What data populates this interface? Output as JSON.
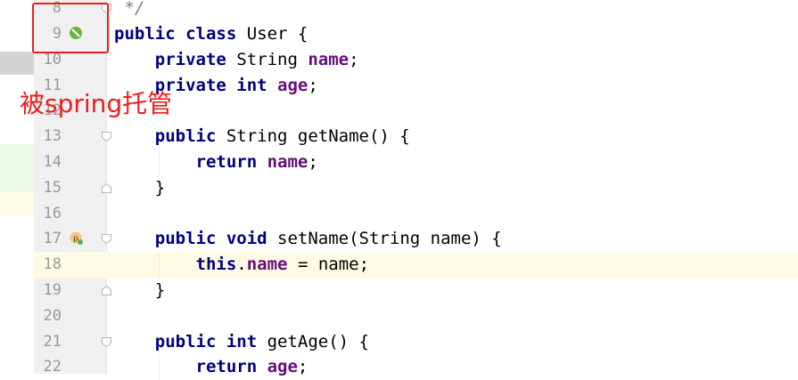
{
  "theme": {
    "keyword_color": "#000080",
    "field_color": "#660e7a",
    "comment_color": "#808080",
    "line_number_color": "#999999",
    "current_line_bg": "#fffae3",
    "annotation_color": "#e8201d",
    "gutter_bg": "#f0f0f0"
  },
  "annotation": {
    "text": "被spring托管"
  },
  "gutter_icons": {
    "line9": "spring-bean-icon",
    "line17": "property-setter-icon"
  },
  "editor": {
    "current_line": "18",
    "lines": [
      {
        "n": "8",
        "tokens": [
          {
            "t": " */",
            "c": "com"
          }
        ]
      },
      {
        "n": "9",
        "tokens": [
          {
            "t": "public ",
            "c": "kw"
          },
          {
            "t": "class ",
            "c": "kw"
          },
          {
            "t": "User {",
            "c": ""
          }
        ]
      },
      {
        "n": "10",
        "tokens": [
          {
            "t": "    ",
            "c": ""
          },
          {
            "t": "private ",
            "c": "kw"
          },
          {
            "t": "String ",
            "c": ""
          },
          {
            "t": "name",
            "c": "fld"
          },
          {
            "t": ";",
            "c": ""
          }
        ]
      },
      {
        "n": "11",
        "tokens": [
          {
            "t": "    ",
            "c": ""
          },
          {
            "t": "private ",
            "c": "kw"
          },
          {
            "t": "int ",
            "c": "kw"
          },
          {
            "t": "age",
            "c": "fld"
          },
          {
            "t": ";",
            "c": ""
          }
        ]
      },
      {
        "n": "12",
        "tokens": []
      },
      {
        "n": "13",
        "tokens": [
          {
            "t": "    ",
            "c": ""
          },
          {
            "t": "public ",
            "c": "kw"
          },
          {
            "t": "String getName() {",
            "c": ""
          }
        ]
      },
      {
        "n": "14",
        "tokens": [
          {
            "t": "        ",
            "c": ""
          },
          {
            "t": "return ",
            "c": "kw"
          },
          {
            "t": "name",
            "c": "fld"
          },
          {
            "t": ";",
            "c": ""
          }
        ]
      },
      {
        "n": "15",
        "tokens": [
          {
            "t": "    }",
            "c": ""
          }
        ]
      },
      {
        "n": "16",
        "tokens": []
      },
      {
        "n": "17",
        "tokens": [
          {
            "t": "    ",
            "c": ""
          },
          {
            "t": "public ",
            "c": "kw"
          },
          {
            "t": "void ",
            "c": "kw"
          },
          {
            "t": "setName(String name) {",
            "c": ""
          }
        ]
      },
      {
        "n": "18",
        "tokens": [
          {
            "t": "        ",
            "c": ""
          },
          {
            "t": "this",
            "c": "kw"
          },
          {
            "t": ".",
            "c": ""
          },
          {
            "t": "name",
            "c": "fld"
          },
          {
            "t": " = name;",
            "c": ""
          }
        ]
      },
      {
        "n": "19",
        "tokens": [
          {
            "t": "    }",
            "c": ""
          }
        ]
      },
      {
        "n": "20",
        "tokens": []
      },
      {
        "n": "21",
        "tokens": [
          {
            "t": "    ",
            "c": ""
          },
          {
            "t": "public ",
            "c": "kw"
          },
          {
            "t": "int ",
            "c": "kw"
          },
          {
            "t": "getAge() {",
            "c": ""
          }
        ]
      },
      {
        "n": "22",
        "tokens": [
          {
            "t": "        ",
            "c": ""
          },
          {
            "t": "return ",
            "c": "kw"
          },
          {
            "t": "age",
            "c": "fld"
          },
          {
            "t": ";",
            "c": ""
          }
        ]
      }
    ]
  }
}
